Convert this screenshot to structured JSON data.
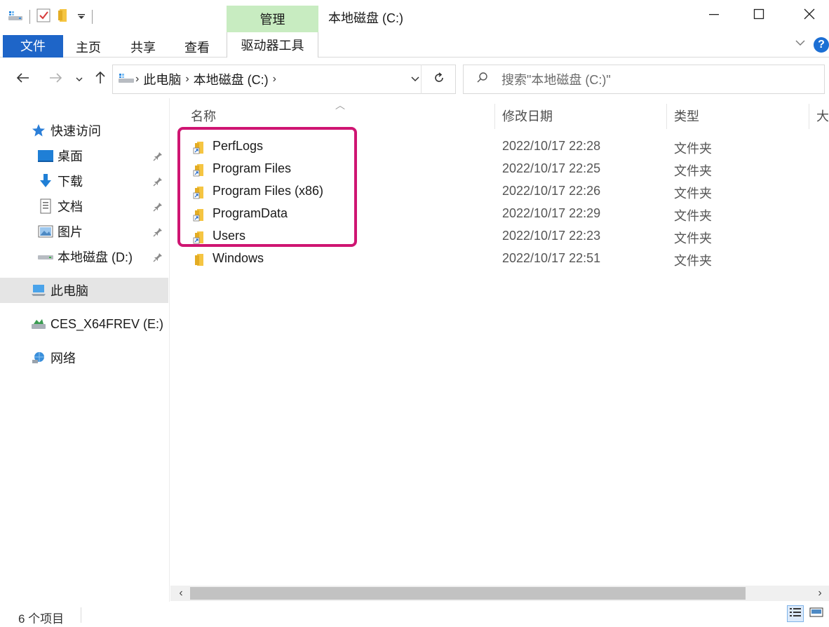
{
  "window": {
    "title": "本地磁盘 (C:)",
    "context_group_label": "管理"
  },
  "ribbon": {
    "file_tab": "文件",
    "tabs": [
      "主页",
      "共享",
      "查看"
    ],
    "context_tab": "驱动器工具"
  },
  "address": {
    "breadcrumbs": [
      "此电脑",
      "本地磁盘 (C:)"
    ],
    "search_placeholder": "搜索\"本地磁盘 (C:)\""
  },
  "nav_pane": {
    "quick_access": "快速访问",
    "items": [
      {
        "label": "桌面",
        "icon": "desktop-icon",
        "pinned": true
      },
      {
        "label": "下载",
        "icon": "download-icon",
        "pinned": true
      },
      {
        "label": "文档",
        "icon": "document-icon",
        "pinned": true
      },
      {
        "label": "图片",
        "icon": "picture-icon",
        "pinned": true
      },
      {
        "label": "本地磁盘 (D:)",
        "icon": "drive-icon",
        "pinned": true
      }
    ],
    "this_pc": "此电脑",
    "usb_drive": "CES_X64FREV (E:)",
    "network": "网络"
  },
  "columns": {
    "name": "名称",
    "modified": "修改日期",
    "type": "类型",
    "size": "大"
  },
  "files": [
    {
      "name": "PerfLogs",
      "modified": "2022/10/17 22:28",
      "type": "文件夹",
      "shortcut": true
    },
    {
      "name": "Program Files",
      "modified": "2022/10/17 22:25",
      "type": "文件夹",
      "shortcut": true
    },
    {
      "name": "Program Files (x86)",
      "modified": "2022/10/17 22:26",
      "type": "文件夹",
      "shortcut": true
    },
    {
      "name": "ProgramData",
      "modified": "2022/10/17 22:29",
      "type": "文件夹",
      "shortcut": true
    },
    {
      "name": "Users",
      "modified": "2022/10/17 22:23",
      "type": "文件夹",
      "shortcut": true
    },
    {
      "name": "Windows",
      "modified": "2022/10/17 22:51",
      "type": "文件夹",
      "shortcut": false
    }
  ],
  "status": {
    "item_count": "6 个项目"
  },
  "colors": {
    "accent": "#1e65c8",
    "context_tab": "#c8ecc1",
    "highlight_box": "#cf1572",
    "folder": "#f5c542"
  }
}
